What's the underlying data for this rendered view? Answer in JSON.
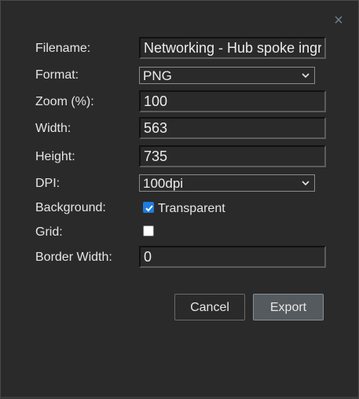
{
  "dialog": {
    "close_symbol": "×",
    "close_icon": "close-icon"
  },
  "fields": {
    "filename": {
      "label": "Filename:",
      "value": "Networking - Hub spoke ingre"
    },
    "format": {
      "label": "Format:",
      "value": "PNG"
    },
    "zoom": {
      "label": "Zoom (%):",
      "value": "100"
    },
    "width": {
      "label": "Width:",
      "value": "563"
    },
    "height": {
      "label": "Height:",
      "value": "735"
    },
    "dpi": {
      "label": "DPI:",
      "value": "100dpi"
    },
    "background": {
      "label": "Background:",
      "checked": true,
      "option_label": "Transparent"
    },
    "grid": {
      "label": "Grid:",
      "checked": false
    },
    "border_width": {
      "label": "Border Width:",
      "value": "0"
    }
  },
  "buttons": {
    "cancel": "Cancel",
    "export": "Export"
  },
  "colors": {
    "dialog_bg": "#2a2a2a",
    "checkbox_accent": "#1e7be0",
    "export_bg": "#555a5e",
    "close_icon": "#6f7f95"
  }
}
